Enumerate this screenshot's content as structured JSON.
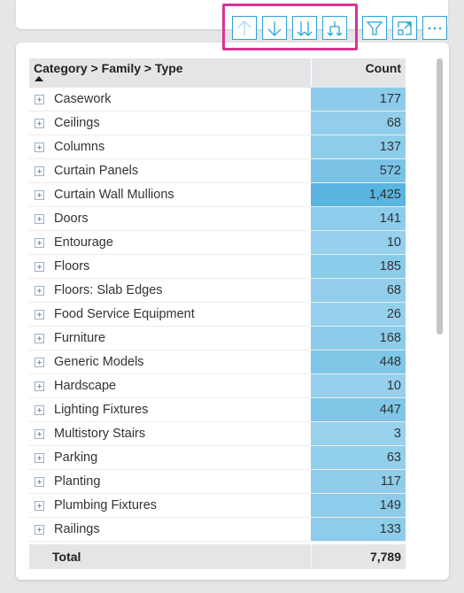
{
  "toolbar": {
    "icons": [
      "arrow-up-icon",
      "arrow-down-icon",
      "double-arrow-down-icon",
      "expand-hierarchy-icon",
      "filter-icon",
      "focus-mode-icon",
      "more-options-icon"
    ]
  },
  "colors": {
    "accent": "#2ea3d5",
    "highlight": "#d63591",
    "bar_low": "#97d1ec",
    "bar_high": "#5ab4e0"
  },
  "table": {
    "headers": {
      "category": "Category > Family > Type",
      "count": "Count"
    },
    "rows": [
      {
        "label": "Casework",
        "count": "177",
        "value": 177
      },
      {
        "label": "Ceilings",
        "count": "68",
        "value": 68
      },
      {
        "label": "Columns",
        "count": "137",
        "value": 137
      },
      {
        "label": "Curtain Panels",
        "count": "572",
        "value": 572
      },
      {
        "label": "Curtain Wall Mullions",
        "count": "1,425",
        "value": 1425
      },
      {
        "label": "Doors",
        "count": "141",
        "value": 141
      },
      {
        "label": "Entourage",
        "count": "10",
        "value": 10
      },
      {
        "label": "Floors",
        "count": "185",
        "value": 185
      },
      {
        "label": "Floors: Slab Edges",
        "count": "68",
        "value": 68
      },
      {
        "label": "Food Service Equipment",
        "count": "26",
        "value": 26
      },
      {
        "label": "Furniture",
        "count": "168",
        "value": 168
      },
      {
        "label": "Generic Models",
        "count": "448",
        "value": 448
      },
      {
        "label": "Hardscape",
        "count": "10",
        "value": 10
      },
      {
        "label": "Lighting Fixtures",
        "count": "447",
        "value": 447
      },
      {
        "label": "Multistory Stairs",
        "count": "3",
        "value": 3
      },
      {
        "label": "Parking",
        "count": "63",
        "value": 63
      },
      {
        "label": "Planting",
        "count": "117",
        "value": 117
      },
      {
        "label": "Plumbing Fixtures",
        "count": "149",
        "value": 149
      },
      {
        "label": "Railings",
        "count": "133",
        "value": 133
      }
    ],
    "total": {
      "label": "Total",
      "count": "7,789"
    }
  }
}
